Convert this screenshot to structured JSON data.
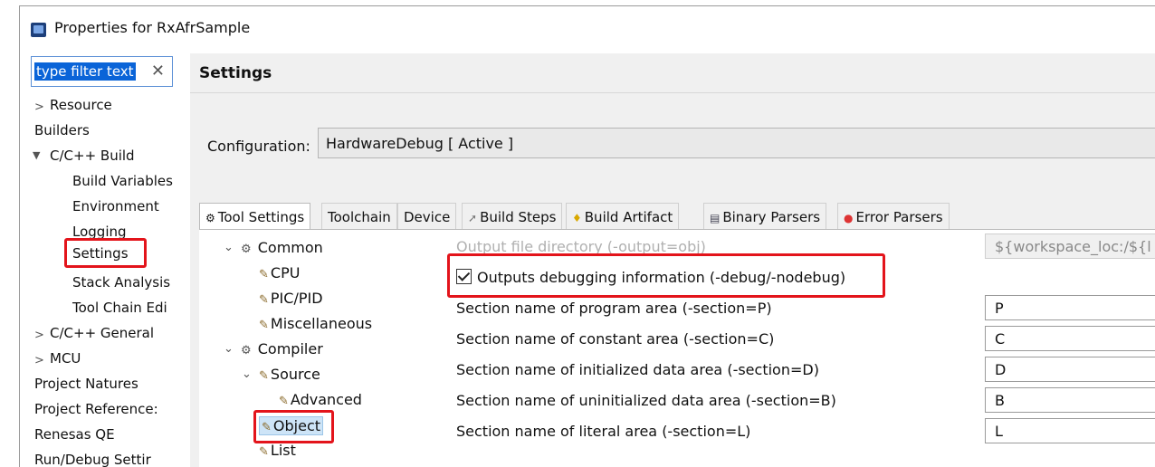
{
  "window": {
    "title": "Properties for RxAfrSample"
  },
  "filter": {
    "value": "type filter text",
    "clear_icon": "✕"
  },
  "left_nav": {
    "items": [
      {
        "label": "Resource",
        "chevron": ">"
      },
      {
        "label": "Builders"
      },
      {
        "label": "C/C++ Build",
        "chevron": "v"
      },
      {
        "label": "Build Variables"
      },
      {
        "label": "Environment"
      },
      {
        "label": "Logging"
      },
      {
        "label": "Settings"
      },
      {
        "label": "Stack Analysis"
      },
      {
        "label": "Tool Chain Edi"
      },
      {
        "label": "C/C++ General",
        "chevron": ">"
      },
      {
        "label": "MCU",
        "chevron": ">"
      },
      {
        "label": "Project Natures"
      },
      {
        "label": "Project Reference:"
      },
      {
        "label": "Renesas QE"
      },
      {
        "label": "Run/Debug Settir"
      }
    ]
  },
  "settings": {
    "title": "Settings"
  },
  "configuration": {
    "label": "Configuration:",
    "value": "HardwareDebug  [ Active ]"
  },
  "tabs": [
    {
      "label": "Tool Settings",
      "icon": "tool-settings-icon"
    },
    {
      "label": "Toolchain"
    },
    {
      "label": "Device"
    },
    {
      "label": "Build Steps",
      "icon": "build-steps-icon"
    },
    {
      "label": "Build Artifact",
      "icon": "build-artifact-icon"
    },
    {
      "label": "Binary Parsers",
      "icon": "binary-parsers-icon"
    },
    {
      "label": "Error Parsers",
      "icon": "error-parsers-icon"
    }
  ],
  "tool_tree": {
    "items": [
      {
        "label": "Common"
      },
      {
        "label": "CPU"
      },
      {
        "label": "PIC/PID"
      },
      {
        "label": "Miscellaneous"
      },
      {
        "label": "Compiler"
      },
      {
        "label": "Source"
      },
      {
        "label": "Advanced"
      },
      {
        "label": "Object"
      },
      {
        "label": "List"
      }
    ]
  },
  "options": {
    "output_dir": {
      "label": "Output file directory (-output=obj)",
      "value": "${workspace_loc:/${l"
    },
    "debug": {
      "label": "Outputs debugging information (-debug/-nodebug)",
      "checked": true
    },
    "rows": [
      {
        "label": "Section name of program area (-section=P)",
        "value": "P"
      },
      {
        "label": "Section name of constant area (-section=C)",
        "value": "C"
      },
      {
        "label": "Section name of initialized data area (-section=D)",
        "value": "D"
      },
      {
        "label": "Section name of uninitialized data area (-section=B)",
        "value": "B"
      },
      {
        "label": "Section name of literal area (-section=L)",
        "value": "L"
      }
    ]
  },
  "colors": {
    "highlight": "#e3141b",
    "selection": "#0a64d8"
  }
}
